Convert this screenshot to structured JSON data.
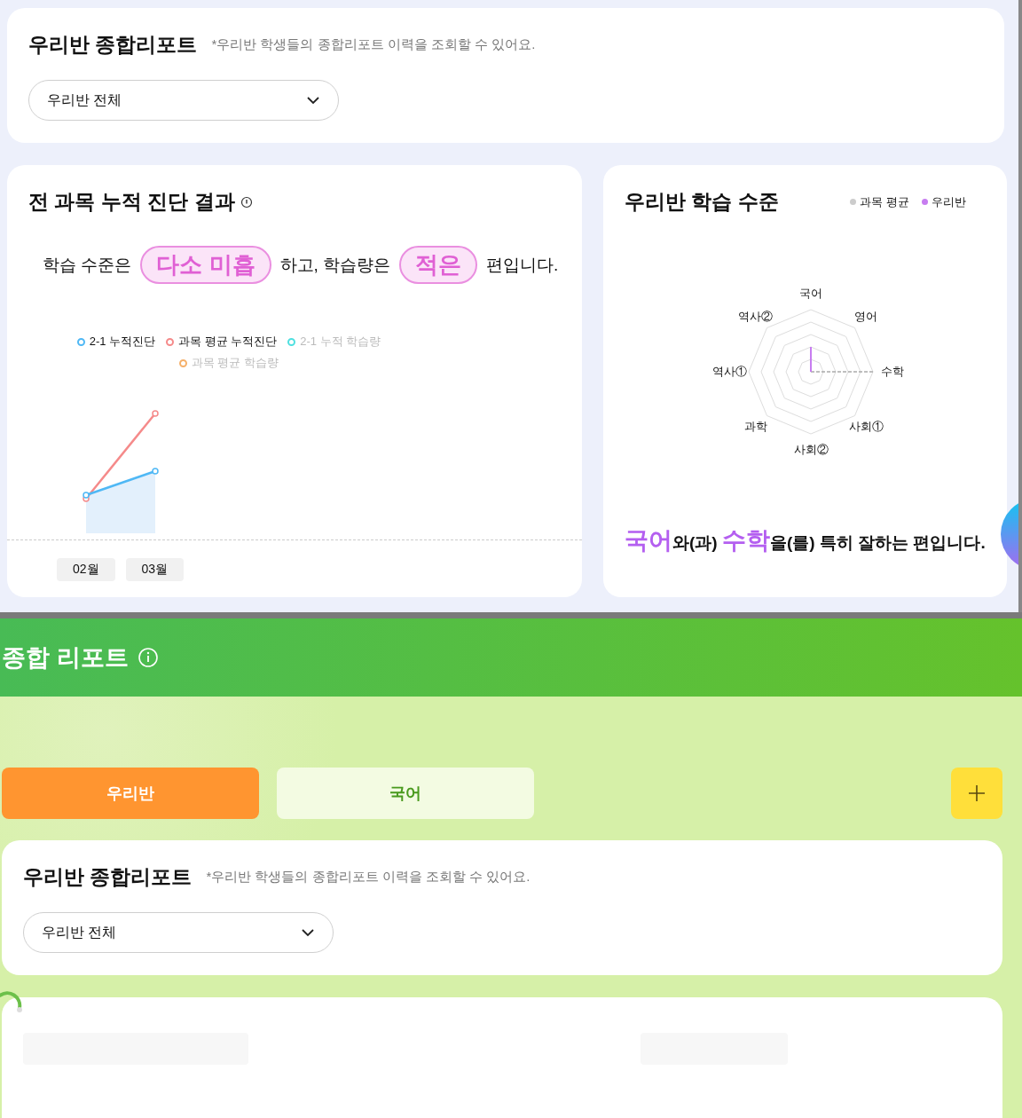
{
  "report_header": {
    "title": "우리반 종합리포트",
    "note": "*우리반 학생들의 종합리포트 이력을 조회할 수 있어요.",
    "select": {
      "value": "우리반 전체"
    }
  },
  "cumulative_card": {
    "title": "전 과목 누적 진단 결과",
    "summary": [
      {
        "kind": "text",
        "text": "학습 수준은"
      },
      {
        "kind": "badge",
        "text": "다소 미흡"
      },
      {
        "kind": "text",
        "text": "하고, 학습량은"
      },
      {
        "kind": "badge",
        "text": "적은"
      },
      {
        "kind": "text",
        "text": "편입니다."
      }
    ],
    "legend": [
      {
        "label": "2-1 누적진단",
        "color": "#4fb8f5",
        "active": true
      },
      {
        "label": "과목 평균 누적진단",
        "color": "#f58a8a",
        "active": true
      },
      {
        "label": "2-1 누적 학습량",
        "color": "#4fe0e0",
        "active": false
      },
      {
        "label": "과목 평균 학습량",
        "color": "#f5b06a",
        "active": false
      }
    ],
    "months": [
      "02월",
      "03월"
    ]
  },
  "level_card": {
    "title": "우리반 학습 수준",
    "legend": [
      {
        "label": "과목 평균",
        "color": "#cccccc"
      },
      {
        "label": "우리반",
        "color": "#c77df0"
      }
    ],
    "axes": [
      "국어",
      "영어",
      "수학",
      "사회①",
      "사회②",
      "과학",
      "역사①",
      "역사②"
    ],
    "summary": "**국어**와(과) **수학**을(를) 특히 잘하는 편입니다."
  },
  "page_header": {
    "title": "종합 리포트"
  },
  "tabs": [
    {
      "label": "우리반",
      "selected": true
    },
    {
      "label": "국어",
      "selected": false
    }
  ],
  "report_header_2": {
    "title": "우리반 종합리포트",
    "note": "*우리반 학생들의 종합리포트 이력을 조회할 수 있어요.",
    "select": {
      "value": "우리반 전체"
    }
  }
}
